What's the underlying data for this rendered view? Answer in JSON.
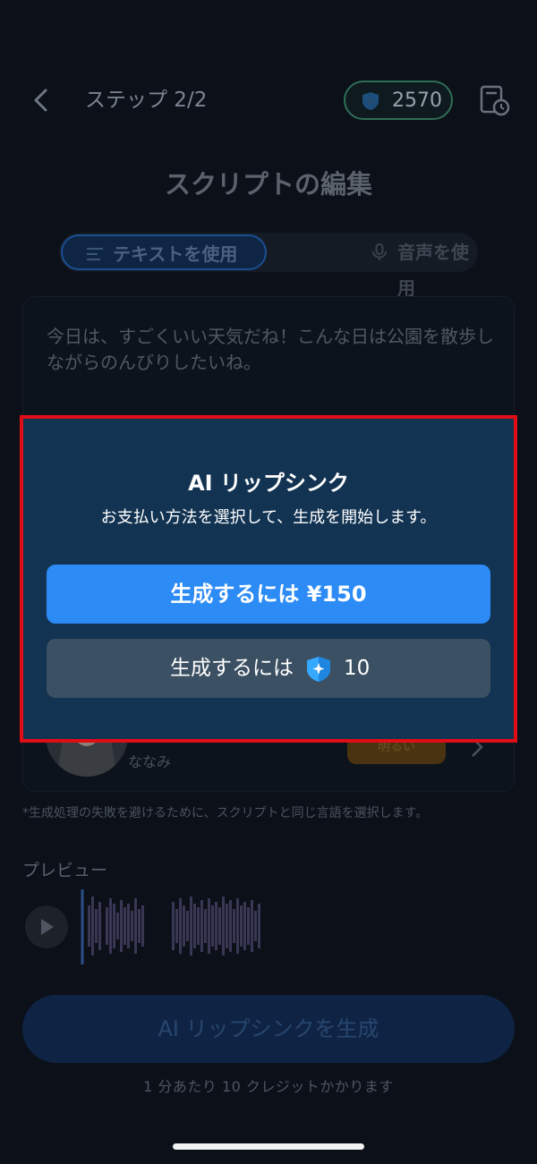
{
  "header": {
    "step": "ステップ 2/2",
    "credits": "2570"
  },
  "page_title": "スクリプトの編集",
  "tabs": [
    {
      "label": "テキストを使用",
      "icon": "text-lines-icon",
      "selected": true
    },
    {
      "label": "音声を使用",
      "icon": "microphone-icon",
      "selected": false
    }
  ],
  "script": {
    "text": "今日は、すごくいい天気だね！こんな日は公園を散歩しながらのんびりしたいね。"
  },
  "voice": {
    "name": "ななみ",
    "tag": "明るい"
  },
  "note": "*生成処理の失敗を避けるために、スクリプトと同じ言語を選択します。",
  "preview": {
    "label": "プレビュー"
  },
  "generate_button": "AI リップシンクを生成",
  "cost_note": "1 分あたり 10 クレジットかかります",
  "modal": {
    "title": "AI リップシンク",
    "subtitle": "お支払い方法を選択して、生成を開始します。",
    "pay_cash_label": "生成するには ¥150",
    "pay_credits_label": "生成するには",
    "pay_credits_amount": "10"
  },
  "colors": {
    "accent": "#2c8bf5",
    "modal_bg": "#123352",
    "highlight": "#e00d16",
    "credit_icon": "#35a8ff"
  }
}
